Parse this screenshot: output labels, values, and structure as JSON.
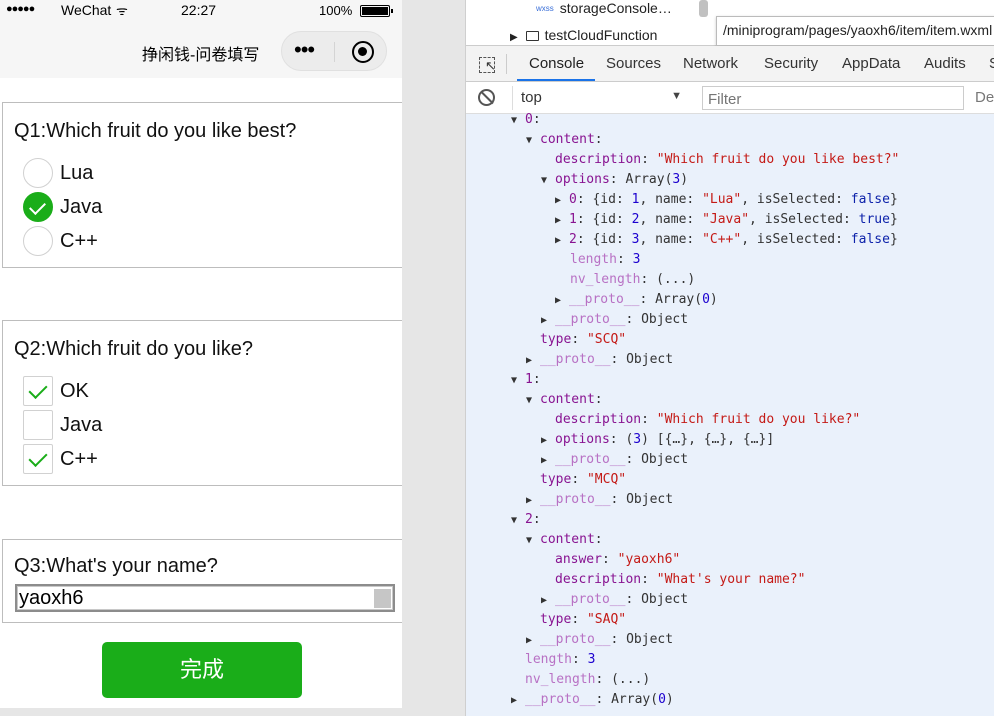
{
  "phone": {
    "status": {
      "signal_dots": "●●●●●",
      "carrier": "WeChat",
      "wifi": "ᯤ",
      "time": "22:27",
      "battery": "100%"
    },
    "nav": {
      "title": "挣闲钱-问卷填写",
      "more_glyph": "•••"
    },
    "questions": [
      {
        "title": "Q1:Which fruit do you like best?",
        "options": [
          {
            "label": "Lua"
          },
          {
            "label": "Java"
          },
          {
            "label": "C++"
          }
        ]
      },
      {
        "title": "Q2:Which fruit do you like?",
        "options": [
          {
            "label": "OK"
          },
          {
            "label": "Java"
          },
          {
            "label": "C++"
          }
        ]
      },
      {
        "title": "Q3:What's your name?",
        "answer": "yaoxh6"
      }
    ],
    "submit_label": "完成"
  },
  "devtools": {
    "tree_items": [
      "storageConsole…",
      "testCloudFunction"
    ],
    "wxss_badge": "wxss",
    "tooltip": "/miniprogram/pages/yaoxh6/item/item.wxml",
    "tabs": [
      "Console",
      "Sources",
      "Network",
      "Security",
      "AppData",
      "Audits",
      "S"
    ],
    "active_tab": "Console",
    "context": "top",
    "filter_placeholder": "Filter",
    "level": "Default levels",
    "console_lines": [
      "▼0:",
      "▼content:",
      "description: \"Which fruit do you like best?\"",
      "▼options: Array(3)",
      "▶0: {id: 1, name: \"Lua\", isSelected: false}",
      "▶1: {id: 2, name: \"Java\", isSelected: true}",
      "▶2: {id: 3, name: \"C++\", isSelected: false}",
      "length: 3",
      "nv_length: (...)",
      "▶__proto__: Array(0)",
      "▶__proto__: Object",
      "type: \"SCQ\"",
      "▶__proto__: Object",
      "▼1:",
      "▼content:",
      "description: \"Which fruit do you like?\"",
      "▶options: (3) [{…}, {…}, {…}]",
      "▶__proto__: Object",
      "type: \"MCQ\"",
      "▶__proto__: Object",
      "▼2:",
      "▼content:",
      "answer: \"yaoxh6\"",
      "description: \"What's your name?\"",
      "▶__proto__: Object",
      "type: \"SAQ\"",
      "▶__proto__: Object",
      "length: 3",
      "nv_length: (...)",
      "▶__proto__: Array(0)"
    ]
  },
  "colors": {
    "wechat_green": "#1aad19",
    "console_bg": "#eaf1fb",
    "key_purple": "#881391",
    "string_red": "#c41a16",
    "number_blue": "#1c00cf",
    "tab_accent": "#1a73e8"
  },
  "icons": [
    "signal-icon",
    "wifi-icon",
    "battery-icon",
    "more-icon",
    "close-target-icon",
    "radio-icon",
    "checkbox-icon",
    "folder-arrow-icon",
    "inspect-icon",
    "clear-console-icon",
    "dropdown-arrow-icon",
    "expand-arrow-icon",
    "collapse-arrow-icon"
  ]
}
